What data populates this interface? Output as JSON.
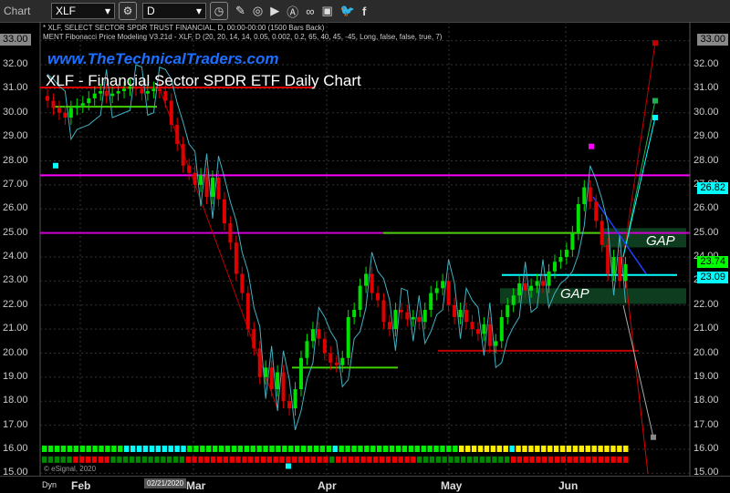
{
  "toolbar": {
    "title": "Chart",
    "symbol": "XLF",
    "interval": "D",
    "icons": [
      "pencil-icon",
      "indicator-icon",
      "play-icon",
      "alert-icon",
      "link-icon",
      "eps-icon",
      "comment-icon",
      "twitter-icon",
      "facebook-icon"
    ]
  },
  "info": {
    "line1": "* XLF, SELECT SECTOR SPDR TRUST FINANCIAL, D, 00:00-00:00 (1500 Bars Back)",
    "line2": "MENT Fibonacci Price Modeling V3.21d - XLF, D (20, 20, 14, 14, 0.05, 0.002, 0.2, 65, 40, 45, -45, Long, false, false, true, 7)"
  },
  "watermark": "www.TheTechnicalTraders.com",
  "chart_title": "XLF - Financial Sector SPDR ETF Daily Chart",
  "gap_labels": [
    "GAP",
    "GAP"
  ],
  "copyright": "© eSignal, 2020",
  "price_axis": [
    "33.00",
    "32.00",
    "31.00",
    "30.00",
    "29.00",
    "28.00",
    "27.00",
    "26.00",
    "25.00",
    "24.00",
    "23.00",
    "22.00",
    "21.00",
    "20.00",
    "19.00",
    "18.00",
    "17.00",
    "16.00",
    "15.00"
  ],
  "price_tags": {
    "left_top": "33.00",
    "right_top": "33.00",
    "t1": "26.82",
    "t2": "23.74",
    "t3": "23.09"
  },
  "x_axis": {
    "dyn": "Dyn",
    "months": [
      "Feb",
      "Mar",
      "Apr",
      "May",
      "Jun"
    ],
    "cursor_date": "02/21/2020"
  },
  "colors": {
    "up": "#00e000",
    "down": "#e00000",
    "magenta": "#ff00ff",
    "cyan": "#00ffff"
  },
  "closes": [
    30.5,
    30.2,
    30.0,
    29.8,
    30.2,
    30.3,
    30.4,
    30.6,
    30.8,
    30.9,
    30.7,
    30.8,
    30.9,
    31.0,
    31.1,
    31.0,
    30.8,
    30.9,
    31.0,
    30.9,
    30.5,
    29.5,
    28.7,
    27.8,
    27.5,
    27.0,
    27.4,
    26.5,
    27.3,
    26.4,
    25.4,
    24.6,
    23.3,
    22.5,
    21.0,
    20.2,
    19.0,
    19.4,
    18.5,
    19.2,
    18.0,
    17.7,
    18.5,
    19.8,
    20.5,
    21.0,
    20.6,
    20.0,
    19.6,
    19.5,
    19.8,
    21.5,
    21.8,
    22.8,
    23.3,
    22.5,
    22.2,
    21.3,
    21.0,
    21.8,
    21.7,
    21.4,
    21.5,
    21.3,
    21.8,
    22.5,
    22.7,
    23.0,
    22.0,
    21.5,
    21.8,
    21.3,
    21.0,
    20.8,
    21.2,
    20.3,
    20.5,
    21.5,
    22.0,
    22.4,
    22.9,
    22.6,
    22.8,
    23.0,
    22.8,
    23.4,
    23.8,
    24.0,
    24.3,
    25.0,
    26.2,
    26.9,
    26.3,
    25.5,
    24.5,
    23.3,
    24.0,
    23.0,
    23.7
  ],
  "status_row1": "GGGGGGGGGGGGGCCCCCCCCCCGGGGGGGGGGGGGGGGGGGGGGGCGGGGGGGGGGGGGGGGGGGYYYYYYYYCYYYYYYYYYYYYYYYYYY",
  "status_row2": "DDDDDRRRRRRDDDDDDDDDDDDRRRRRRRRRRRRRRRRRRRRRRRDRRRRRRRRRRRRRDDDDDDDDDDDDDDDRRRRRRRRRRRRRRRRRRR"
}
